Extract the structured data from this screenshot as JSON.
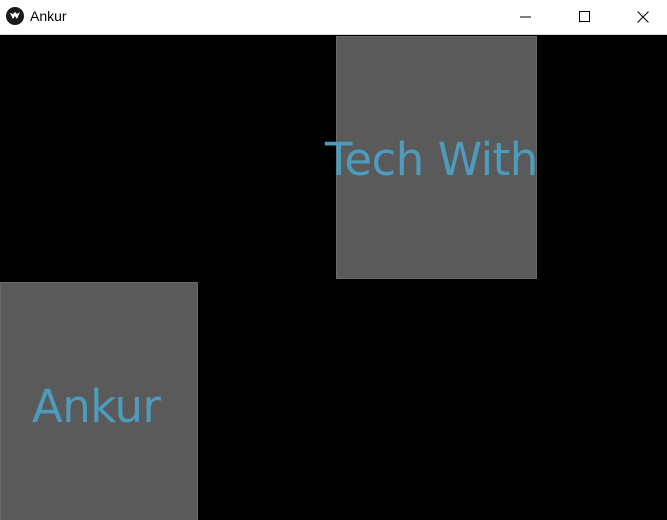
{
  "window": {
    "title": "Ankur"
  },
  "titlebar": {
    "app_icon": "kivy-logo-icon",
    "controls": [
      "minimize-icon",
      "maximize-icon",
      "close-icon"
    ]
  },
  "buttons": [
    {
      "label": "Tech With",
      "background": "#5a5a5a",
      "text_color": "#4d9bbd"
    },
    {
      "label": "Ankur",
      "background": "#5a5a5a",
      "text_color": "#4d9bbd"
    }
  ]
}
